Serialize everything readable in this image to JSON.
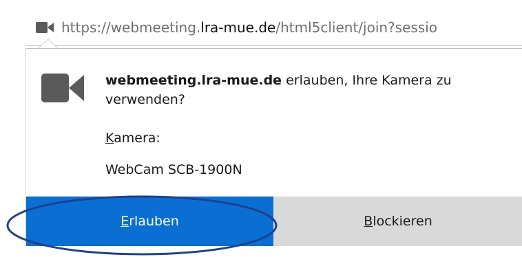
{
  "addressbar": {
    "url_prefix": "https://webmeeting.",
    "url_host": "lra-mue.de",
    "url_suffix": "/html5client/join?sessio",
    "icon": "camera-icon"
  },
  "dialog": {
    "site": "webmeeting.lra-mue.de",
    "message_rest": " erlauben, Ihre Kamera zu verwenden?",
    "camera_label": "Kamera:",
    "camera_value": "WebCam SCB-1900N",
    "icon": "camera-icon"
  },
  "buttons": {
    "allow_label": "Erlauben",
    "block_label": "Blockieren"
  },
  "colors": {
    "allow_button": "#0a6fd2",
    "block_button": "#d9d9d9",
    "highlight_ellipse": "#1f3f8f",
    "camera_icon": "#5a5a5a"
  }
}
